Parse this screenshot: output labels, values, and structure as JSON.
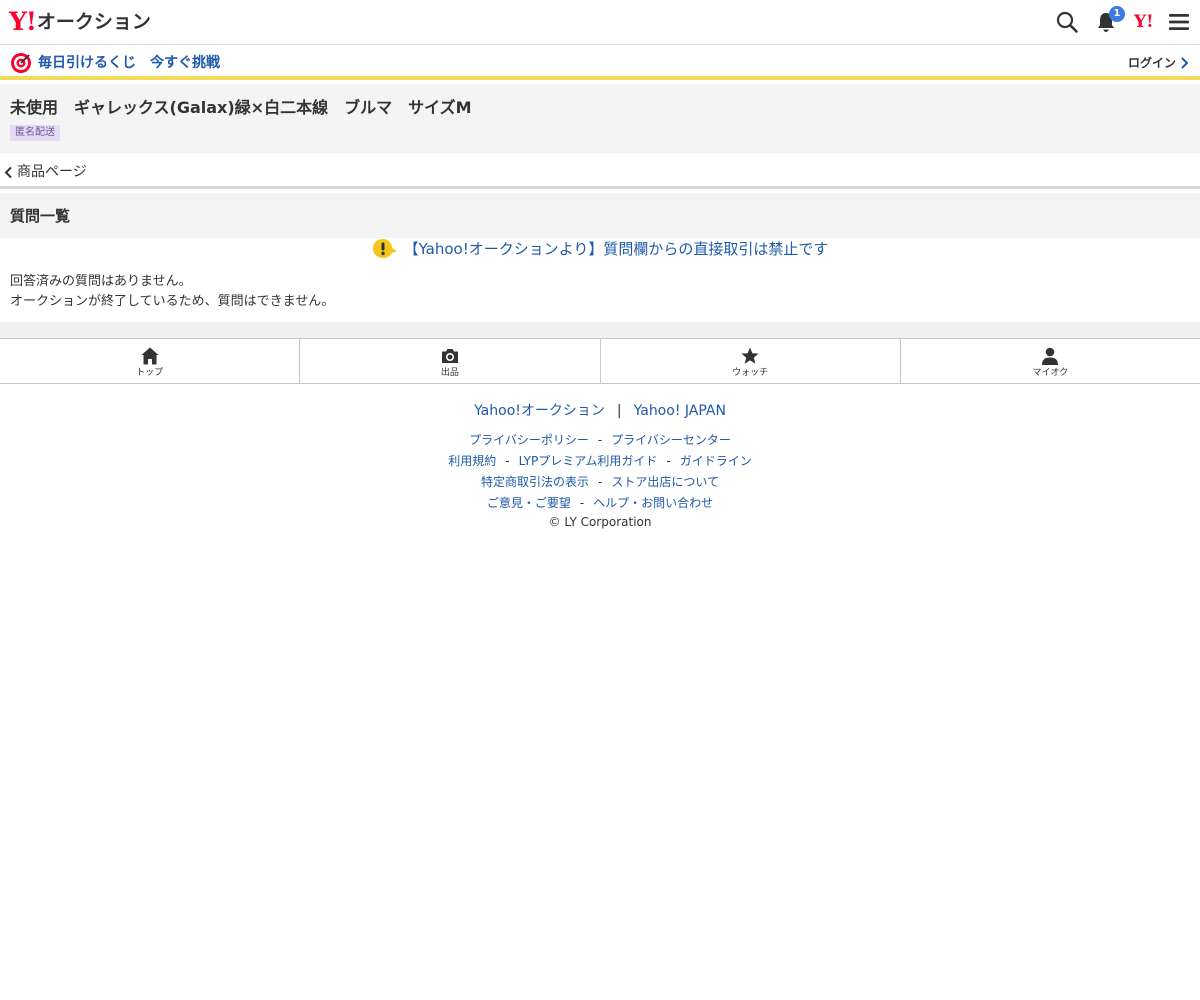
{
  "header": {
    "logo_y": "Y!",
    "logo_text": "オークション",
    "notification_count": "1",
    "yj_logo": "Y!",
    "icons": [
      "search-icon",
      "bell-icon",
      "menu-icon"
    ]
  },
  "promo": {
    "text": "毎日引けるくじ　今すぐ挑戦",
    "login_label": "ログイン"
  },
  "item": {
    "title": "未使用　ギャレックス(Galax)緑×白二本線　ブルマ　サイズM",
    "badge": "匿名配送"
  },
  "back": {
    "label": "商品ページ"
  },
  "questions": {
    "heading": "質問一覧",
    "notice": "【Yahoo!オークションより】質問欄からの直接取引は禁止です",
    "no_answers": "回答済みの質問はありません。",
    "closed": "オークションが終了しているため、質問はできません。"
  },
  "nav": {
    "items": [
      {
        "label": "トップ",
        "icon": "home-icon"
      },
      {
        "label": "出品",
        "icon": "camera-icon"
      },
      {
        "label": "ウォッチ",
        "icon": "star-icon"
      },
      {
        "label": "マイオク",
        "icon": "user-icon"
      }
    ]
  },
  "footer": {
    "main_links": [
      "Yahoo!オークション",
      "Yahoo! JAPAN"
    ],
    "main_sep": "|",
    "links": [
      [
        "プライバシーポリシー",
        "プライバシーセンター"
      ],
      [
        "利用規約",
        "LYPプレミアム利用ガイド",
        "ガイドライン"
      ],
      [
        "特定商取引法の表示",
        "ストア出店について"
      ],
      [
        "ご意見・ご要望",
        "ヘルプ・お問い合わせ"
      ]
    ],
    "dash": "-",
    "copyright": "© LY Corporation"
  },
  "colors": {
    "brand_red": "#ff0033",
    "link_blue": "#1e5aa8",
    "promo_border": "#f2da5a",
    "badge_bg": "#e5d9f5",
    "notify_blue": "#3d7be0"
  }
}
